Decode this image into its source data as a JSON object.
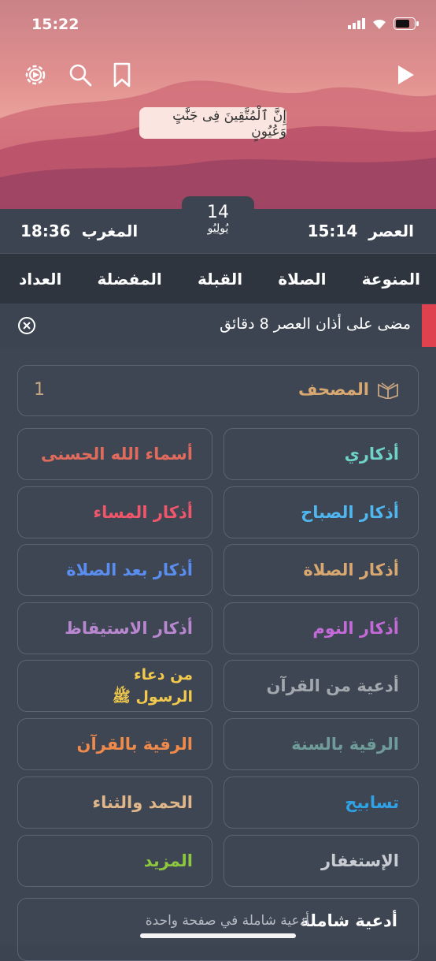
{
  "status": {
    "time": "15:22"
  },
  "verse": {
    "text": "إِنَّ ٱلْمُتَّقِينَ فِى جَنَّٰتٍ وَعُيُونٍ"
  },
  "prayer": {
    "left_name": "المغرب",
    "left_time": "18:36",
    "right_name": "العصر",
    "right_time": "15:14"
  },
  "date": {
    "day": "14",
    "month": "يُولِيُو"
  },
  "tabs": [
    "المنوعة",
    "الصلاة",
    "القبلة",
    "المفضلة",
    "العداد"
  ],
  "notice": {
    "text": "مضى على أذان العصر 8 دقائق"
  },
  "mushaf": {
    "label": "المصحف",
    "value": "1"
  },
  "tiles": [
    {
      "label": "أذكاري",
      "color": "#6fd3c8"
    },
    {
      "label": "أسماء الله الحسنى",
      "color": "#e06b5c"
    },
    {
      "label": "أذكار الصباح",
      "color": "#4fb6ef"
    },
    {
      "label": "أذكار المساء",
      "color": "#f0566a"
    },
    {
      "label": "أذكار الصلاة",
      "color": "#d9a870"
    },
    {
      "label": "أذكار بعد الصلاة",
      "color": "#5a8df0"
    },
    {
      "label": "أذكار النوم",
      "color": "#c46ad8"
    },
    {
      "label": "أذكار الاستيقاظ",
      "color": "#b987d0"
    },
    {
      "label": "أدعية من القرآن",
      "color": "#a3a7ae"
    },
    {
      "label_line1": "من دعاء",
      "label_line2": "الرسول ﷺ",
      "color": "#f2c94c"
    },
    {
      "label": "الرقية بالسنة",
      "color": "#6f9c9a"
    },
    {
      "label": "الرقية بالقرآن",
      "color": "#f08a4b"
    },
    {
      "label": "تسابيح",
      "color": "#2fa2e6"
    },
    {
      "label": "الحمد والثناء",
      "color": "#e0b78a"
    },
    {
      "label": "الإستغفار",
      "color": "#c9ccd2"
    },
    {
      "label": "المزيد",
      "color": "#8dc63f"
    }
  ],
  "bottom_card": {
    "title": "أدعية شاملة",
    "subtitle": "أدعية شاملة في صفحة واحدة"
  }
}
